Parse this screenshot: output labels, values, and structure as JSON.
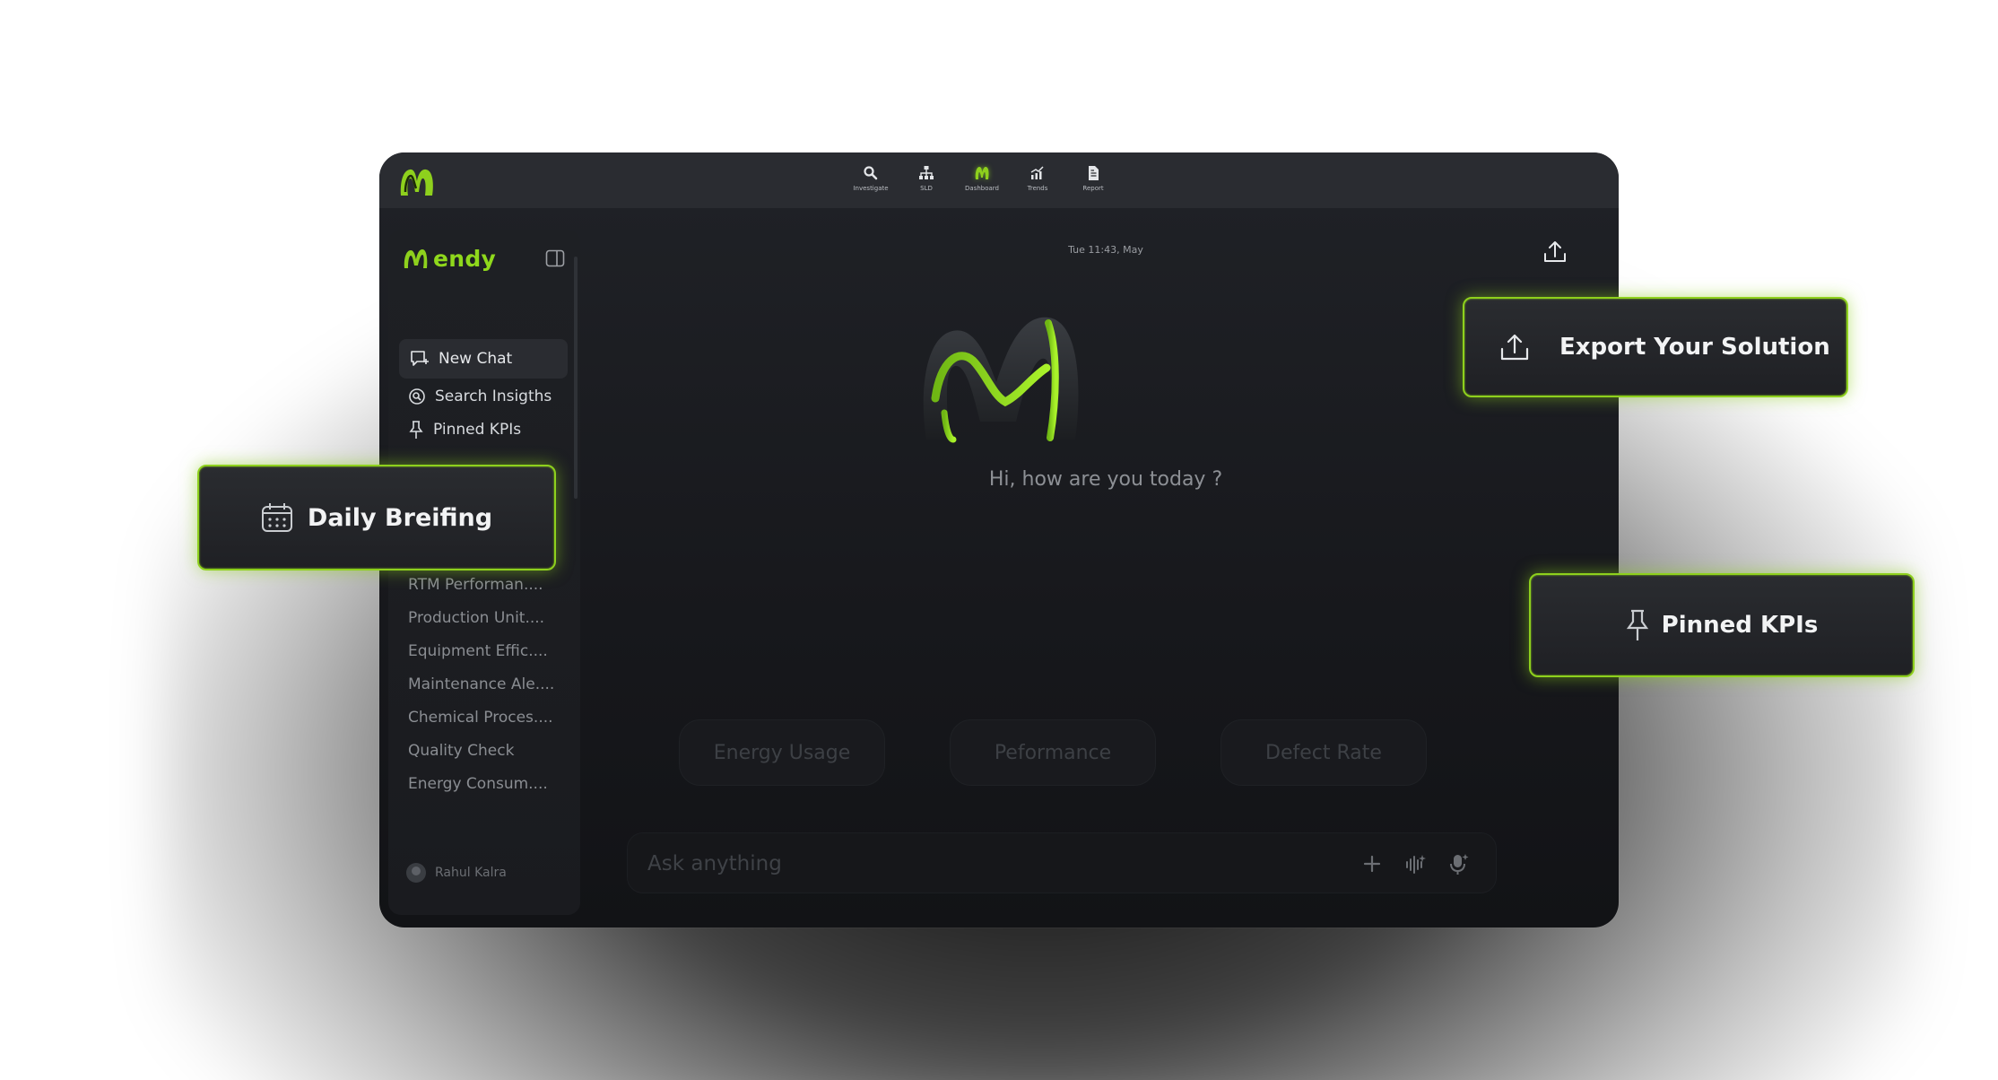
{
  "topnav": {
    "items": [
      {
        "label": "Investigate",
        "icon": "search-icon"
      },
      {
        "label": "SLD",
        "icon": "hierarchy-icon"
      },
      {
        "label": "Dashboard",
        "icon": "logo-icon"
      },
      {
        "label": "Trends",
        "icon": "trend-chart-icon"
      },
      {
        "label": "Report",
        "icon": "document-icon"
      }
    ],
    "active": "Dashboard"
  },
  "sidebar": {
    "brand": "endy",
    "new_chat": "New Chat",
    "menu": [
      {
        "label": "Search Insigths",
        "icon": "search-circle-icon"
      },
      {
        "label": "Pinned KPIs",
        "icon": "pin-icon"
      }
    ],
    "history": [
      "RTM Performan....",
      "Production Unit....",
      "Equipment Effic....",
      "Maintenance Ale....",
      "Chemical Proces....",
      "Quality Check",
      "Energy Consum...."
    ],
    "user_name": "Rahul Kalra"
  },
  "main": {
    "datetime": "Tue 11:43, May",
    "greeting": "Hi, how are you today ?",
    "suggestions": [
      "Energy Usage",
      "Peformance",
      "Defect Rate"
    ],
    "input_placeholder": "Ask anything"
  },
  "callouts": {
    "daily_briefing": "Daily Breifing",
    "export": "Export Your Solution",
    "pinned_kpis": "Pinned KPIs"
  },
  "colors": {
    "accent": "#8ed01d",
    "app_bg": "#1a1b1f",
    "topbar_bg": "#2a2c31"
  }
}
